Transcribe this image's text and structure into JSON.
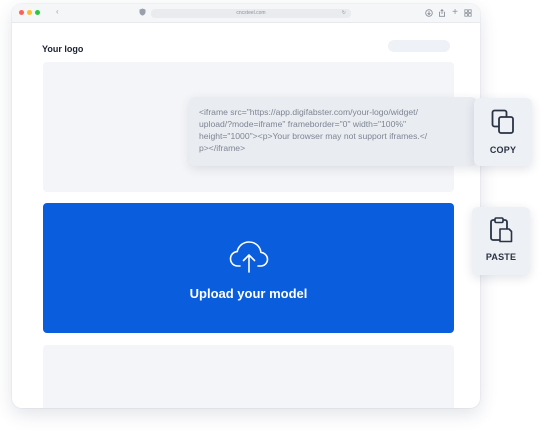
{
  "browser": {
    "url": "cncsteel.com"
  },
  "page": {
    "logo_text": "Your logo"
  },
  "upload": {
    "label": "Upload your model",
    "icon": "cloud-upload-icon"
  },
  "embed_code": {
    "lines": [
      "<iframe src=\"https://app.digifabster.com/your-logo/widget/",
      "upload/?mode=iframe\" frameborder=\"0\" width=\"100%\"",
      "height=\"1000\"><p>Your browser may not support iframes.</",
      "p></iframe>"
    ]
  },
  "actions": {
    "copy_label": "COPY",
    "paste_label": "PASTE"
  },
  "colors": {
    "accent": "#0a5ddc",
    "placeholder": "#f4f5f8",
    "code_bg": "#e9ecf1",
    "card_bg": "#edf0f4"
  }
}
